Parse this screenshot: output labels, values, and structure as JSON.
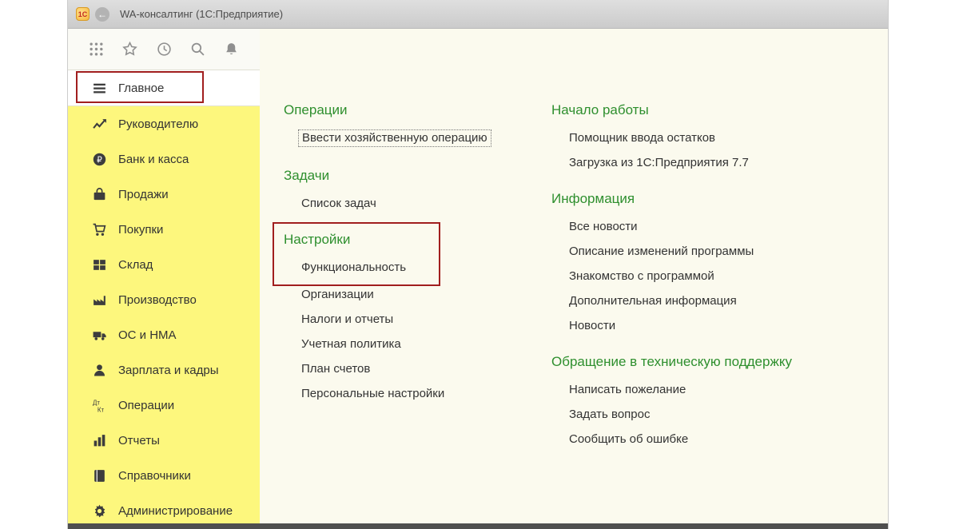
{
  "colors": {
    "accent_green": "#2e8f2e",
    "panel_yellow": "#fdf77d",
    "main_bg": "#fbfaee",
    "highlight_red": "#a11e1e",
    "titlebar_bg": "#dfdfdf"
  },
  "titlebar": {
    "logo": "1С",
    "back_icon": "←",
    "title": "WA-консалтинг  (1С:Предприятие)"
  },
  "sidebar": {
    "toolbar_icons": [
      "menu-grid",
      "favorites-star",
      "history-clock",
      "search",
      "notifications-bell"
    ],
    "items": [
      {
        "label": "Главное",
        "icon": "hamburger",
        "active": true,
        "highlighted": true
      },
      {
        "label": "Руководителю",
        "icon": "trend-chart"
      },
      {
        "label": "Банк и касса",
        "icon": "ruble-circle"
      },
      {
        "label": "Продажи",
        "icon": "bag"
      },
      {
        "label": "Покупки",
        "icon": "cart"
      },
      {
        "label": "Склад",
        "icon": "pallet-grid"
      },
      {
        "label": "Производство",
        "icon": "factory"
      },
      {
        "label": "ОС и НМА",
        "icon": "truck"
      },
      {
        "label": "Зарплата и кадры",
        "icon": "person"
      },
      {
        "label": "Операции",
        "icon": "debit-credit"
      },
      {
        "label": "Отчеты",
        "icon": "bar-chart"
      },
      {
        "label": "Справочники",
        "icon": "book"
      },
      {
        "label": "Администрирование",
        "icon": "gear"
      }
    ]
  },
  "main": {
    "col1": [
      {
        "title": "Операции",
        "items": [
          "Ввести хозяйственную операцию"
        ]
      },
      {
        "title": "Задачи",
        "items": [
          "Список задач"
        ]
      },
      {
        "title": "Настройки",
        "highlighted": true,
        "items": [
          "Функциональность",
          "Организации",
          "Налоги и отчеты",
          "Учетная политика",
          "План счетов",
          "Персональные настройки"
        ]
      }
    ],
    "col2": [
      {
        "title": "Начало работы",
        "items": [
          "Помощник ввода остатков",
          "Загрузка из 1С:Предприятия 7.7"
        ]
      },
      {
        "title": "Информация",
        "items": [
          "Все новости",
          "Описание изменений программы",
          "Знакомство с программой",
          "Дополнительная информация",
          "Новости"
        ]
      },
      {
        "title": "Обращение в техническую поддержку",
        "items": [
          "Написать пожелание",
          "Задать вопрос",
          "Сообщить об ошибке"
        ]
      }
    ]
  },
  "annotations": {
    "highlighted_elements": [
      "Главное",
      "Настройки",
      "Функциональность"
    ]
  }
}
